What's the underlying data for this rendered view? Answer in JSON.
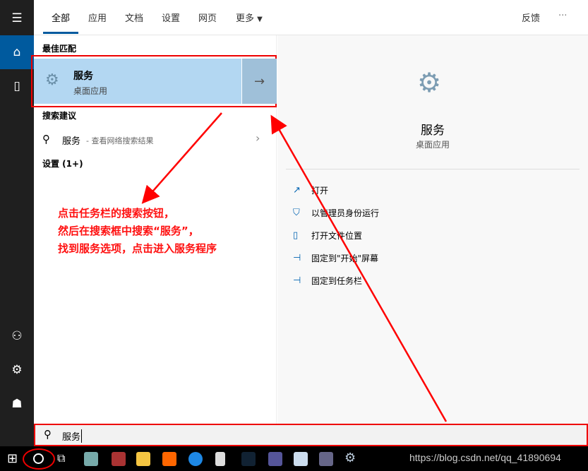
{
  "tabs": [
    "全部",
    "应用",
    "文档",
    "设置",
    "网页",
    "更多"
  ],
  "header_right": {
    "feedback": "反馈",
    "more": "···"
  },
  "left": {
    "best_match_title": "最佳匹配",
    "best_match": {
      "name": "服务",
      "type": "桌面应用"
    },
    "suggest_title": "搜索建议",
    "suggest": {
      "term": "服务",
      "hint": "- 查看网络搜索结果"
    },
    "settings_title": "设置 (1+)"
  },
  "right": {
    "name": "服务",
    "type": "桌面应用",
    "actions": [
      "打开",
      "以管理员身份运行",
      "打开文件位置",
      "固定到\"开始\"屏幕",
      "固定到任务栏"
    ]
  },
  "search": {
    "value": "服务"
  },
  "annotation": [
    "点击任务栏的搜索按钮，",
    "然后在搜索框中搜索“服务”，",
    "找到服务选项，点击进入服务程序"
  ],
  "watermark": "https://blog.csdn.net/qq_41890694",
  "colors": {
    "highlight": "#b3d7f2",
    "accent": "#005a9e",
    "annotation": "#ff0000"
  }
}
